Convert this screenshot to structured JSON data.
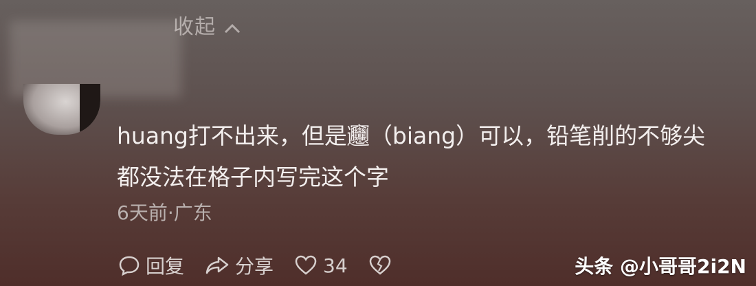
{
  "collapse_label": "收起",
  "comment": {
    "line1": "huang打不出来，但是𰻞（biang）可以，铅笔削的不够尖",
    "line2": "都没法在格子内写完这个字"
  },
  "meta": {
    "time_location": "6天前·广东"
  },
  "actions": {
    "reply_label": "回复",
    "share_label": "分享",
    "like_count": "34"
  },
  "icons": {
    "collapse": "chevron-up-icon",
    "reply": "speech-bubble-icon",
    "share": "share-arrow-icon",
    "like": "heart-icon",
    "dislike": "broken-heart-icon"
  },
  "watermark": "头条 @小哥哥2i2N",
  "colors": {
    "bg_top": "#67605e",
    "bg_bottom": "#4f2e2a",
    "text": "#f3efee",
    "meta": "#b9b0ae"
  }
}
